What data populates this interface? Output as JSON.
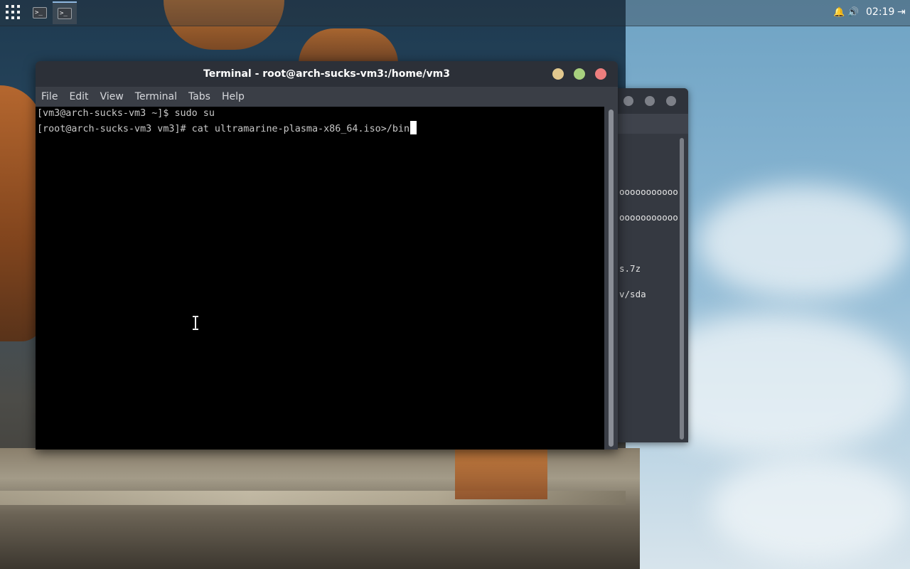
{
  "panel": {
    "apps_icon": "app-grid-icon",
    "tasks": [
      {
        "name": "terminal-task-1",
        "glyph": ">_"
      },
      {
        "name": "terminal-task-2",
        "glyph": ">_"
      }
    ],
    "tray": {
      "notification_icon": "bell-icon",
      "notification_glyph": "🔔",
      "volume_icon": "speaker-icon",
      "volume_glyph": "🔊",
      "clock": "02:19",
      "logout_icon": "logout-icon",
      "logout_glyph": "⇥"
    }
  },
  "background_window": {
    "lines": [
      "ooooooooooo",
      "ooooooooooo",
      "s.7z",
      "v/sda"
    ]
  },
  "terminal": {
    "title": "Terminal - root@arch-sucks-vm3:/home/vm3",
    "menu": [
      "File",
      "Edit",
      "View",
      "Terminal",
      "Tabs",
      "Help"
    ],
    "lines": [
      "[vm3@arch-sucks-vm3 ~]$ sudo su",
      "[root@arch-sucks-vm3 vm3]# cat ultramarine-plasma-x86_64.iso>/bin"
    ],
    "colors": {
      "background": "#000000",
      "text": "#c8c8c8",
      "titlebar": "#2c3038",
      "minimize": "#e2c88e",
      "maximize": "#a7d07e",
      "close": "#ed7e7e"
    }
  }
}
